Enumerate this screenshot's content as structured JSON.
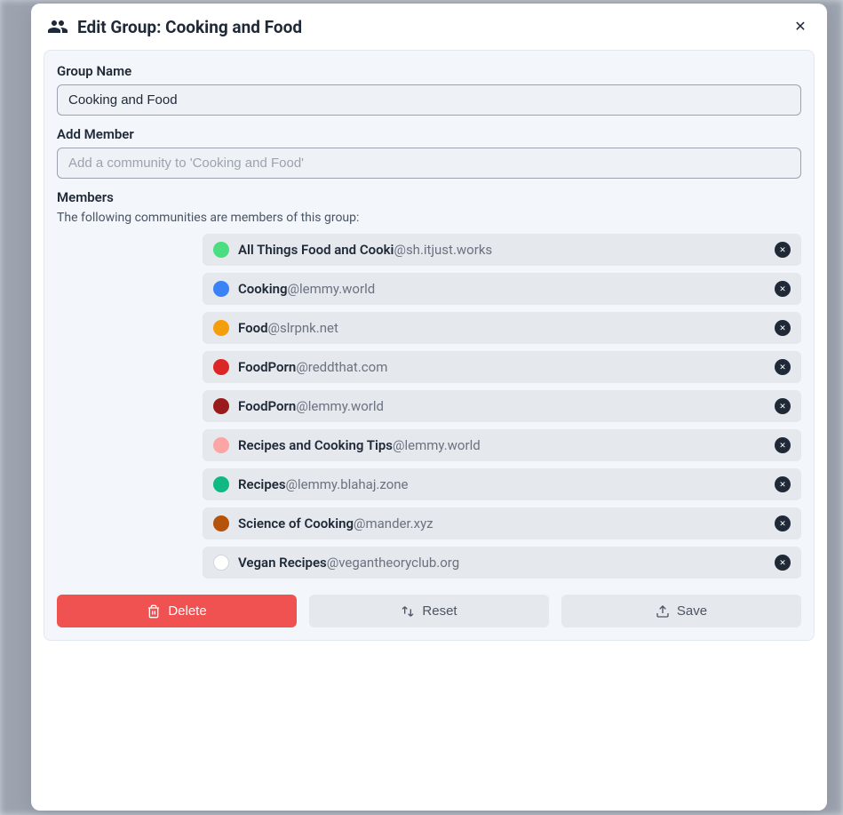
{
  "modal": {
    "title": "Edit Group: Cooking and Food"
  },
  "form": {
    "group_name_label": "Group Name",
    "group_name_value": "Cooking and Food",
    "add_member_label": "Add Member",
    "add_member_placeholder": "Add a community to 'Cooking and Food'",
    "members_label": "Members",
    "members_helper": "The following communities are members of this group:"
  },
  "members": [
    {
      "name": "All Things Food and Cooki",
      "instance": "@sh.itjust.works",
      "avatar_bg": "#4ade80"
    },
    {
      "name": "Cooking",
      "instance": "@lemmy.world",
      "avatar_bg": "#3b82f6"
    },
    {
      "name": "Food",
      "instance": "@slrpnk.net",
      "avatar_bg": "#f59e0b"
    },
    {
      "name": "FoodPorn",
      "instance": "@reddthat.com",
      "avatar_bg": "#dc2626"
    },
    {
      "name": "FoodPorn",
      "instance": "@lemmy.world",
      "avatar_bg": "#991b1b"
    },
    {
      "name": "Recipes and Cooking Tips",
      "instance": "@lemmy.world",
      "avatar_bg": "#fca5a5"
    },
    {
      "name": "Recipes",
      "instance": "@lemmy.blahaj.zone",
      "avatar_bg": "#10b981"
    },
    {
      "name": "Science of Cooking",
      "instance": "@mander.xyz",
      "avatar_bg": "#b45309"
    },
    {
      "name": "Vegan Recipes",
      "instance": "@vegantheoryclub.org",
      "avatar_bg": "#ffffff"
    }
  ],
  "actions": {
    "delete": "Delete",
    "reset": "Reset",
    "save": "Save"
  }
}
